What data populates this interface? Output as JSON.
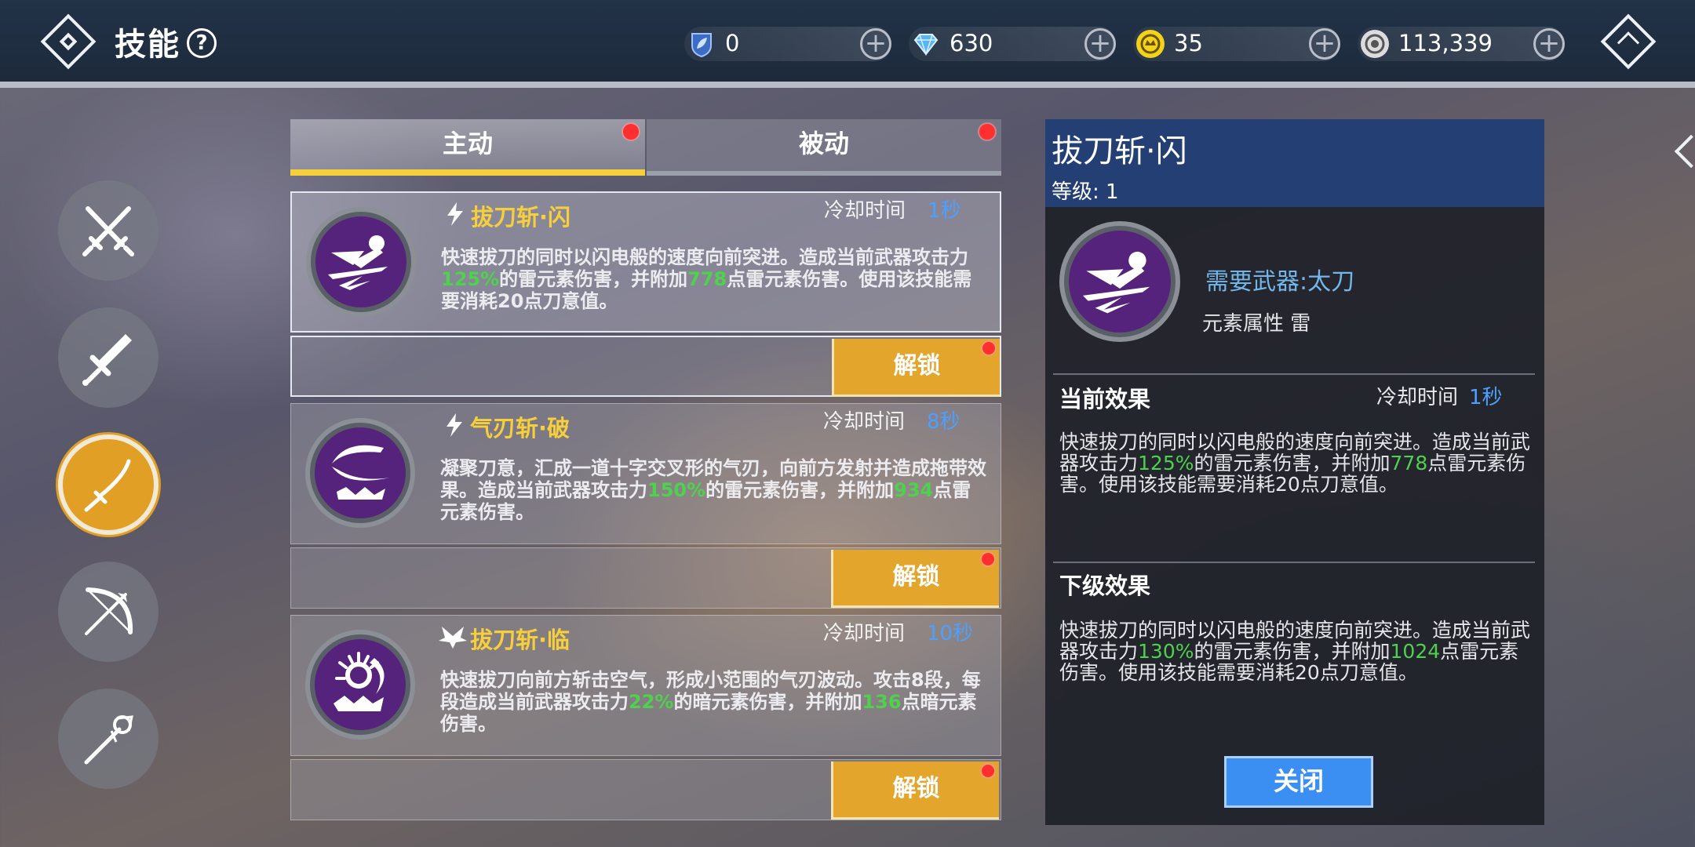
{
  "header": {
    "title": "技能",
    "help_icon": "question-icon"
  },
  "currencies": [
    {
      "name": "leaf-shield",
      "value": "0",
      "color": "#5c8fe0"
    },
    {
      "name": "diamond",
      "value": "630",
      "color": "#5ab4f0"
    },
    {
      "name": "gold-coin",
      "value": "35",
      "color": "#f2d21a"
    },
    {
      "name": "silver-coin",
      "value": "113,339",
      "color": "#e6e6e6"
    }
  ],
  "sidebar": [
    {
      "name": "crossed-swords-icon",
      "active": false
    },
    {
      "name": "greatsword-icon",
      "active": false
    },
    {
      "name": "katana-icon",
      "active": true
    },
    {
      "name": "bow-icon",
      "active": false
    },
    {
      "name": "staff-icon",
      "active": false
    }
  ],
  "tabs": {
    "active": "主动",
    "passive": "被动"
  },
  "skills": [
    {
      "name": "拔刀斩·闪",
      "type_icon": "lightning-icon",
      "cd_label": "冷却时间",
      "cd_value": "1秒",
      "desc": [
        {
          "t": "快速拔刀的同时以闪电般的速度向前突进。造成当前武器攻击力"
        },
        {
          "t": "125%",
          "hl": true
        },
        {
          "t": "的雷元素伤害，并附加"
        },
        {
          "t": "778",
          "hl": true
        },
        {
          "t": "点雷元素伤害。使用该技能需要消耗20点刀意值。"
        }
      ],
      "button": "解锁"
    },
    {
      "name": "气刃斩·破",
      "type_icon": "lightning-icon",
      "cd_label": "冷却时间",
      "cd_value": "8秒",
      "desc": [
        {
          "t": "凝聚刀意，汇成一道十字交叉形的气刃，向前方发射并造成拖带效果。造成当前武器攻击力"
        },
        {
          "t": "150%",
          "hl": true
        },
        {
          "t": "的雷元素伤害，并附加"
        },
        {
          "t": "934",
          "hl": true
        },
        {
          "t": "点雷元素伤害。"
        }
      ],
      "button": "解锁"
    },
    {
      "name": "拔刀斩·临",
      "type_icon": "dark-wings-icon",
      "cd_label": "冷却时间",
      "cd_value": "10秒",
      "desc": [
        {
          "t": "快速拔刀向前方斩击空气，形成小范围的气刃波动。攻击8段，每段造成当前武器攻击力"
        },
        {
          "t": "22%",
          "hl": true
        },
        {
          "t": "的暗元素伤害，并附加"
        },
        {
          "t": "136",
          "hl": true
        },
        {
          "t": "点暗元素伤害。"
        }
      ],
      "button": "解锁"
    }
  ],
  "detail": {
    "title": "拔刀斩·闪",
    "level": "等级: 1",
    "required_weapon": "需要武器:太刀",
    "element": "元素属性  雷",
    "current_title": "当前效果",
    "cd_label": "冷却时间",
    "cd_value": "1秒",
    "current_desc": [
      {
        "t": "快速拔刀的同时以闪电般的速度向前突进。造成当前武器攻击力"
      },
      {
        "t": "125%",
        "hl": true
      },
      {
        "t": "的雷元素伤害，并附加"
      },
      {
        "t": "778",
        "hl": true
      },
      {
        "t": "点雷元素伤害。使用该技能需要消耗20点刀意值。"
      }
    ],
    "next_title": "下级效果",
    "next_desc": [
      {
        "t": "快速拔刀的同时以闪电般的速度向前突进。造成当前武器攻击力"
      },
      {
        "t": "130%",
        "hl": true
      },
      {
        "t": "的雷元素伤害，并附加"
      },
      {
        "t": "1024",
        "hl": true
      },
      {
        "t": "点雷元素伤害。使用该技能需要消耗20点刀意值。"
      }
    ],
    "close": "关闭"
  }
}
